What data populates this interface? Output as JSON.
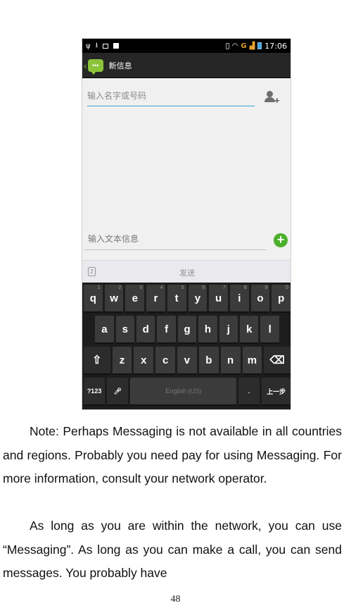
{
  "phone": {
    "status_bar": {
      "time": "17:06",
      "network": "G"
    },
    "action_bar": {
      "title": "新信息"
    },
    "recipient_placeholder": "输入名字或号码",
    "compose_placeholder": "输入文本信息",
    "send_label": "发送",
    "keyboard": {
      "row1": [
        {
          "k": "q",
          "n": "1"
        },
        {
          "k": "w",
          "n": "2"
        },
        {
          "k": "e",
          "n": "3"
        },
        {
          "k": "r",
          "n": "4"
        },
        {
          "k": "t",
          "n": "5"
        },
        {
          "k": "y",
          "n": "6"
        },
        {
          "k": "u",
          "n": "7"
        },
        {
          "k": "i",
          "n": "8"
        },
        {
          "k": "o",
          "n": "9"
        },
        {
          "k": "p",
          "n": "0"
        }
      ],
      "row2": [
        "a",
        "s",
        "d",
        "f",
        "g",
        "h",
        "j",
        "k",
        "l"
      ],
      "row3": [
        "z",
        "x",
        "c",
        "v",
        "b",
        "n",
        "m"
      ],
      "sym_label": "?123",
      "space_label": "English (US)",
      "period_label": ".",
      "prev_label": "上一步"
    }
  },
  "text": {
    "paragraph1": "Note: Perhaps Messaging is not available in all countries and regions. Probably you need pay for using Messaging. For more information, consult your network operator.",
    "paragraph2": "As long as you are within the network, you can use “Messaging”. As long as you can make a call, you can send messages. You probably have",
    "page_number": "48"
  }
}
